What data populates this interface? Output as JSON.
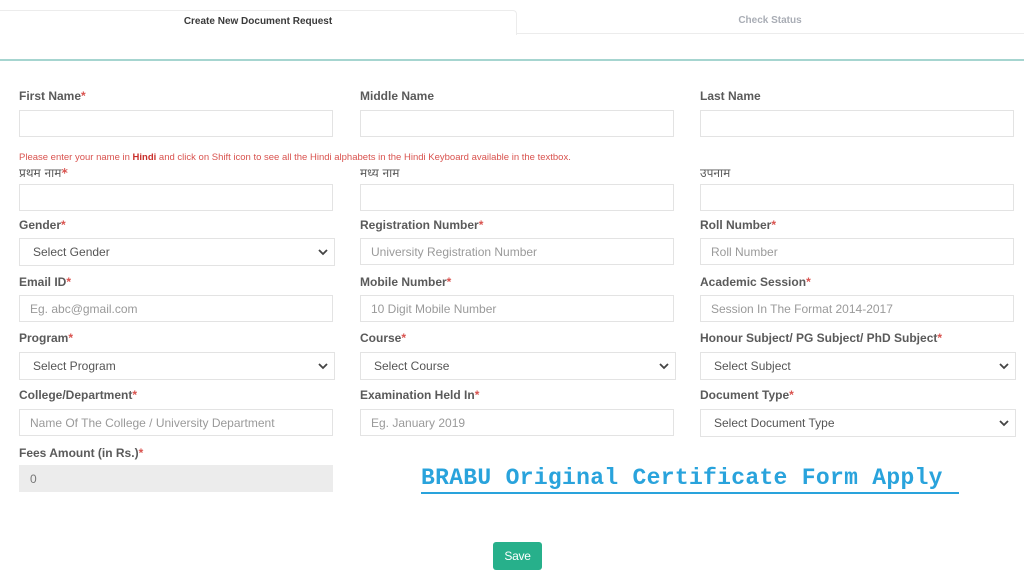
{
  "tabs": [
    {
      "label": "Create New Document Request",
      "active": true
    },
    {
      "label": "Check Status",
      "active": false
    }
  ],
  "required_marker": "*",
  "hindi_note": {
    "before": "Please enter your name in ",
    "bold": "Hindi",
    "after": " and click on Shift icon to see all the Hindi alphabets in the Hindi Keyboard available in the textbox."
  },
  "fields": {
    "first_name": {
      "label": "First Name",
      "required": true,
      "value": ""
    },
    "middle_name": {
      "label": "Middle Name",
      "required": false,
      "value": ""
    },
    "last_name": {
      "label": "Last Name",
      "required": false,
      "value": ""
    },
    "first_name_hindi": {
      "label": "प्रथम नाम",
      "required": true,
      "value": ""
    },
    "middle_name_hindi": {
      "label": "मध्य नाम",
      "required": false,
      "value": ""
    },
    "last_name_hindi": {
      "label": "उपनाम",
      "required": false,
      "value": ""
    },
    "gender": {
      "label": "Gender",
      "required": true,
      "selected": "Select Gender"
    },
    "registration_number": {
      "label": "Registration Number",
      "required": true,
      "placeholder": "University Registration Number"
    },
    "roll_number": {
      "label": "Roll Number",
      "required": true,
      "placeholder": "Roll Number"
    },
    "email": {
      "label": "Email ID",
      "required": true,
      "placeholder": "Eg. abc@gmail.com"
    },
    "mobile": {
      "label": "Mobile Number",
      "required": true,
      "placeholder": "10 Digit Mobile Number"
    },
    "academic_session": {
      "label": "Academic Session",
      "required": true,
      "placeholder": "Session In The Format 2014-2017"
    },
    "program": {
      "label": "Program",
      "required": true,
      "selected": "Select Program"
    },
    "course": {
      "label": "Course",
      "required": true,
      "selected": "Select Course"
    },
    "subject": {
      "label": "Honour Subject/ PG Subject/ PhD Subject",
      "required": true,
      "selected": "Select Subject"
    },
    "college": {
      "label": "College/Department",
      "required": true,
      "placeholder": "Name Of The College / University Department"
    },
    "exam_held_in": {
      "label": "Examination Held In",
      "required": true,
      "placeholder": "Eg. January 2019"
    },
    "document_type": {
      "label": "Document Type",
      "required": true,
      "selected": "Select Document Type"
    },
    "fees_amount": {
      "label": "Fees Amount (in Rs.)",
      "required": true,
      "value": "0"
    }
  },
  "promo_text": "BRABU Original Certificate Form Apply",
  "save_label": "Save",
  "colors": {
    "accent_teal": "#a6d5d0",
    "required_red": "#d9534f",
    "promo_blue": "#29a3dc",
    "save_green": "#27b08b"
  }
}
